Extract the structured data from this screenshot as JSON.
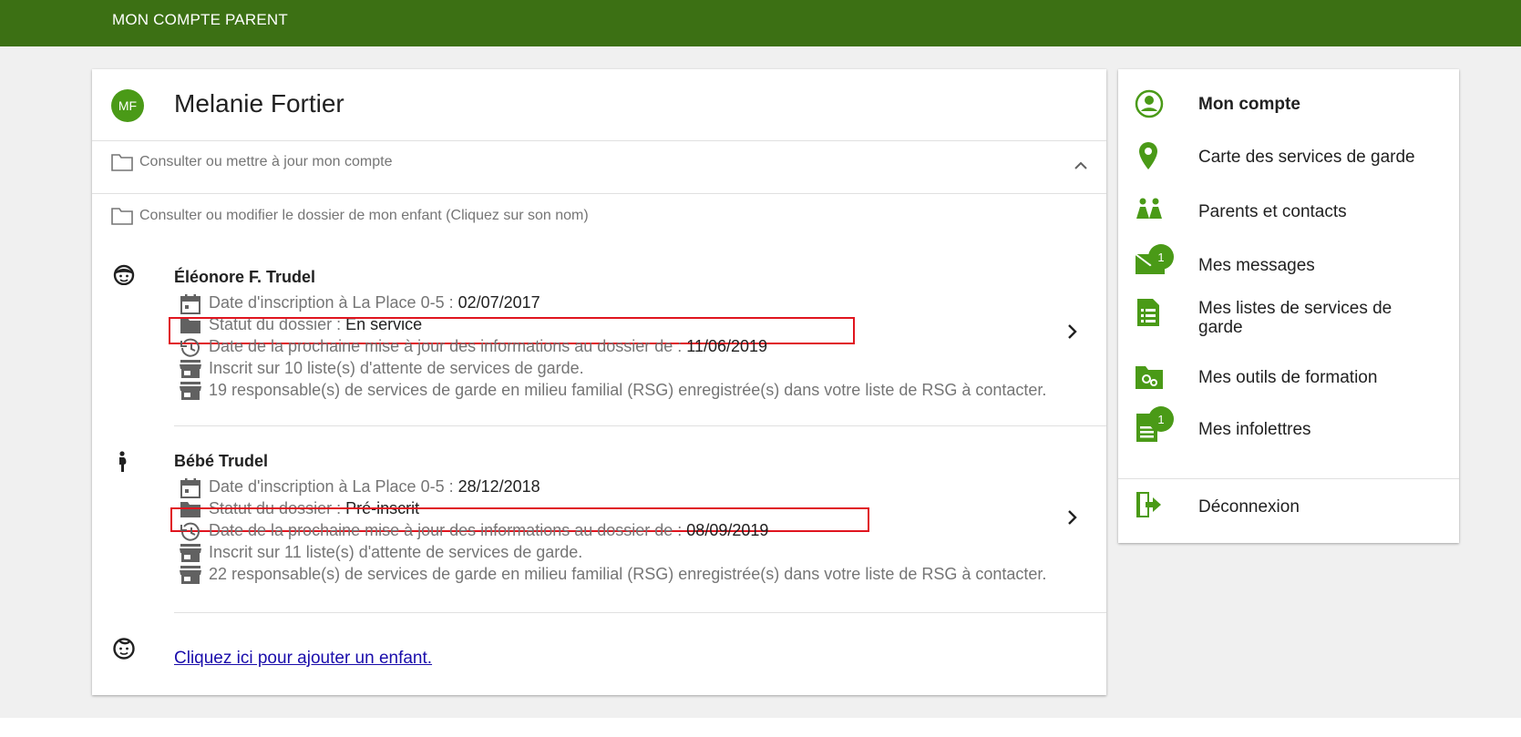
{
  "header": {
    "title": "MON COMPTE PARENT"
  },
  "profile": {
    "initials": "MF",
    "name": "Melanie Fortier"
  },
  "sections": {
    "account": "Consulter ou mettre à jour mon compte",
    "children": "Consulter ou modifier le dossier de mon enfant (Cliquez sur son nom)"
  },
  "children": [
    {
      "name": "Éléonore F. Trudel",
      "registration_label": "Date d'inscription à La Place 0-5 : ",
      "registration_date": "02/07/2017",
      "status_label": "Statut du dossier : ",
      "status": "En service",
      "update_label": "Date de la prochaine mise à jour des informations au dossier de : ",
      "update_date": "11/06/2019",
      "waitlists": "Inscrit sur 10 liste(s) d'attente de services de garde.",
      "rsg": "19 responsable(s) de services de garde en milieu familial (RSG) enregistrée(s) dans votre liste de RSG à contacter."
    },
    {
      "name": "Bébé Trudel",
      "registration_label": "Date d'inscription à La Place 0-5 : ",
      "registration_date": "28/12/2018",
      "status_label": "Statut du dossier : ",
      "status": "Pré-inscrit",
      "update_label": "Date de la prochaine mise à jour des informations au dossier de : ",
      "update_date": "08/09/2019",
      "waitlists": "Inscrit sur 11 liste(s) d'attente de services de garde.",
      "rsg": "22 responsable(s) de services de garde en milieu familial (RSG) enregistrée(s) dans votre liste de RSG à contacter."
    }
  ],
  "add_child_link": "Cliquez ici pour ajouter un enfant.",
  "sidebar": {
    "items": [
      {
        "label": "Mon compte",
        "icon": "account-circle-icon"
      },
      {
        "label": "Carte des services de garde",
        "icon": "map-pin-icon"
      },
      {
        "label": "Parents et contacts",
        "icon": "people-icon"
      },
      {
        "label": "Mes messages",
        "icon": "envelope-icon",
        "badge": "1"
      },
      {
        "label": "Mes listes de services de garde",
        "icon": "list-icon"
      },
      {
        "label": "Mes outils de formation",
        "icon": "training-folder-icon"
      },
      {
        "label": "Mes infolettres",
        "icon": "newsletter-icon",
        "badge": "1"
      },
      {
        "label": "Déconnexion",
        "icon": "logout-icon"
      }
    ]
  },
  "colors": {
    "header_green": "#3c7014",
    "accent_green": "#4a9a17",
    "highlight_red": "#e0151f",
    "link_blue": "#1a0dab"
  }
}
